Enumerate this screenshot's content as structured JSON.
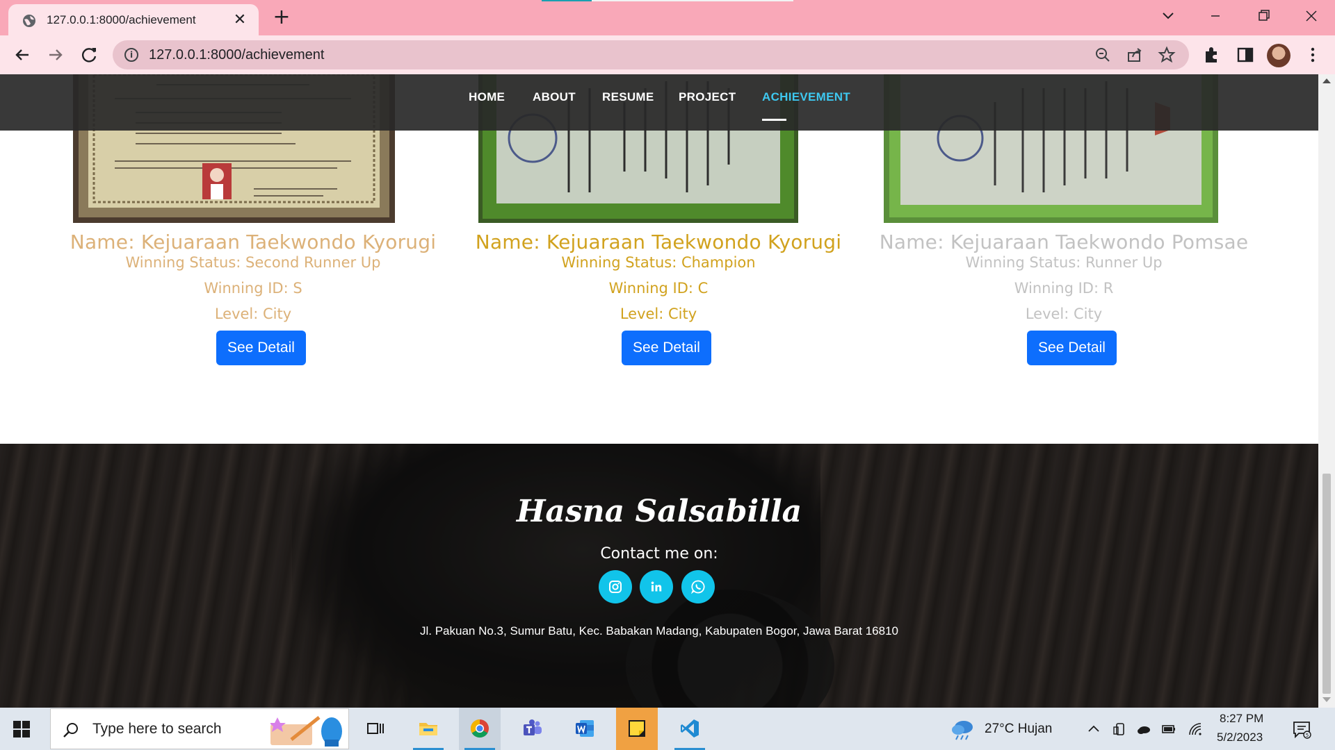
{
  "browser": {
    "tab_title": "127.0.0.1:8000/achievement",
    "url": "127.0.0.1:8000/achievement",
    "tab_close": "✕",
    "new_tab": "+"
  },
  "site_nav": {
    "items": [
      "HOME",
      "ABOUT",
      "RESUME",
      "PROJECT",
      "ACHIEVEMENT"
    ],
    "active": "ACHIEVEMENT"
  },
  "achievements": [
    {
      "name": "Name: Kejuaraan Taekwondo Kyorugi",
      "status": "Winning Status: Second Runner Up",
      "winning_id": "Winning ID: S",
      "level": "Level: City",
      "button": "See Detail",
      "color": "#dcb178"
    },
    {
      "name": "Name: Kejuaraan Taekwondo Kyorugi",
      "status": "Winning Status: Champion",
      "winning_id": "Winning ID: C",
      "level": "Level: City",
      "button": "See Detail",
      "color": "#d1a21e"
    },
    {
      "name": "Name: Kejuaraan Taekwondo Pomsae",
      "status": "Winning Status: Runner Up",
      "winning_id": "Winning ID: R",
      "level": "Level: City",
      "button": "See Detail",
      "color": "#c2c2c2"
    }
  ],
  "footer": {
    "brand": "Hasna Salsabilla",
    "contact_heading": "Contact me on:",
    "social_icons": [
      "instagram-icon",
      "linkedin-icon",
      "whatsapp-icon"
    ],
    "address": "Jl. Pakuan No.3, Sumur Batu, Kec. Babakan Madang, Kabupaten Bogor, Jawa Barat 16810"
  },
  "taskbar": {
    "search_placeholder": "Type here to search",
    "weather": "27°C  Hujan",
    "time": "8:27 PM",
    "date": "5/2/2023"
  },
  "colors": {
    "accent_nav": "#3ec8f0",
    "button_blue": "#0d6efd",
    "social_cyan": "#11c4ea",
    "tab_strip": "#f9a8b8"
  }
}
